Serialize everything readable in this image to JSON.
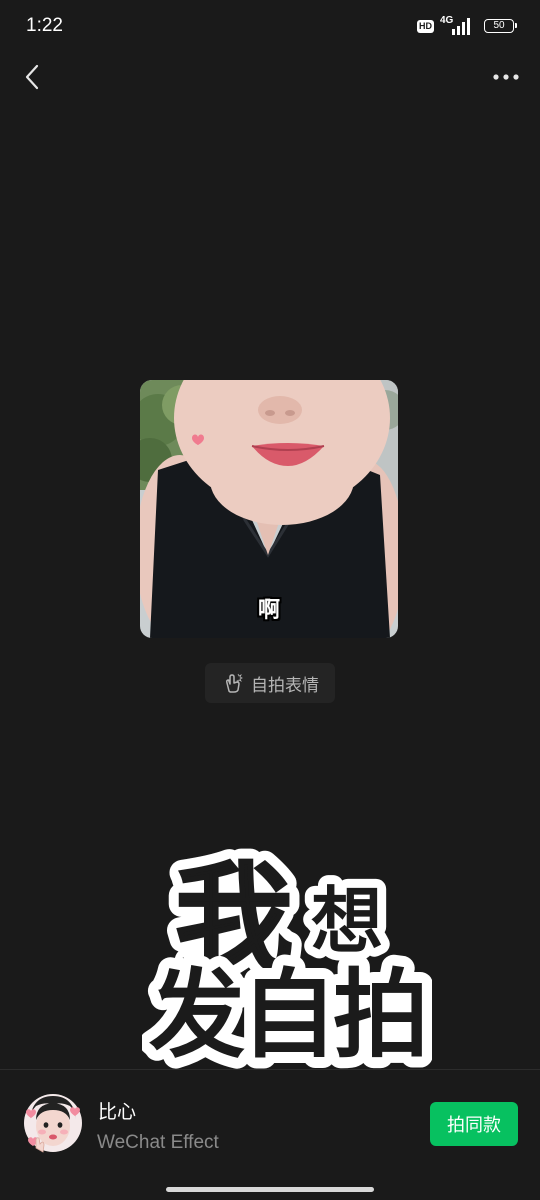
{
  "status_bar": {
    "time": "1:22",
    "hd_badge": "HD",
    "network": "4G",
    "battery": "50"
  },
  "sticker": {
    "caption": "啊"
  },
  "selfie_button": {
    "label": "自拍表情",
    "icon": "finger-heart-icon"
  },
  "promo_text": {
    "line1": "我想",
    "line2": "发自拍",
    "small_char": "想"
  },
  "effect": {
    "name": "比心",
    "subtitle": "WeChat Effect",
    "button_label": "拍同款",
    "button_color": "#07c160"
  },
  "colors": {
    "background": "#1a1a1a",
    "accent": "#07c160"
  }
}
